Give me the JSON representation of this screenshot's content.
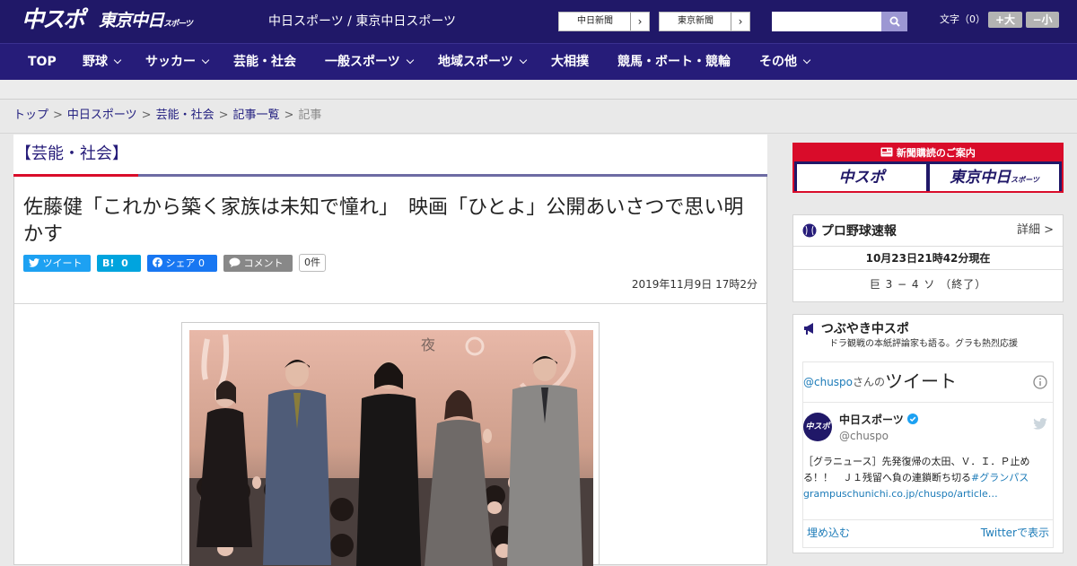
{
  "header": {
    "logo_chuspo": "中スポ",
    "logo_tokyo": "東京中日",
    "logo_tokyo_sub": "スポーツ",
    "site_title": "中日スポーツ / 東京中日スポーツ",
    "ext_links": [
      {
        "label": "中日新聞",
        "arrow": "›"
      },
      {
        "label": "東京新聞",
        "arrow": "›"
      }
    ],
    "search": {
      "placeholder": "",
      "icon": "search-icon"
    },
    "font_size": {
      "label": "文字（0）",
      "larger": "+大",
      "smaller": "−小"
    }
  },
  "nav": [
    {
      "label": "TOP",
      "dropdown": false
    },
    {
      "label": "野球",
      "dropdown": true
    },
    {
      "label": "サッカー",
      "dropdown": true
    },
    {
      "label": "芸能・社会",
      "dropdown": false
    },
    {
      "label": "一般スポーツ",
      "dropdown": true
    },
    {
      "label": "地域スポーツ",
      "dropdown": true
    },
    {
      "label": "大相撲",
      "dropdown": false
    },
    {
      "label": "競馬・ボート・競輪",
      "dropdown": false
    },
    {
      "label": "その他",
      "dropdown": true
    }
  ],
  "breadcrumb": {
    "items": [
      "トップ",
      "中日スポーツ",
      "芸能・社会",
      "記事一覧"
    ],
    "current": "記事",
    "separator": ">"
  },
  "article": {
    "category": "【芸能・社会】",
    "title": "佐藤健「これから築く家族は未知で憧れ」　映画「ひとよ」公開あいさつで思い明かす",
    "share": {
      "tweet": "ツイート",
      "hatena_icon": "B!",
      "hatena_count": "0",
      "facebook": "シェア",
      "facebook_count": "0",
      "comment": "コメント",
      "comment_count": "0件"
    },
    "date": "2019年11月9日 17時2分",
    "photo_overlay_text": "夜"
  },
  "sidebar": {
    "subscribe": {
      "header": "新聞購読のご案内",
      "buttons": [
        "中スポ",
        "東京中日"
      ],
      "tokyo_sub": "スポーツ"
    },
    "baseball": {
      "title": "プロ野球速報",
      "detail": "詳細 >",
      "timestamp": "10月23日21時42分現在",
      "score": "巨 3 − 4 ソ （終了）"
    },
    "tweets": {
      "title": "つぶやき中スポ",
      "subtitle": "ドラ観戦の本紙評論家も語る。グラも熱烈応援",
      "handle_label": "@chuspo",
      "handle_suffix": "さんの",
      "tweet_label": "ツイート",
      "user_name": "中日スポーツ",
      "user_handle": "@chuspo",
      "avatar_text": "中スポ",
      "tweet_text": "［グラニュース］先発復帰の太田、Ｖ．Ｉ．Ｐ止める！！　Ｊ１残留へ負の連鎖断ち切る",
      "tweet_hashtag": "#グランパス",
      "tweet_link": "grampuschunichi.co.jp/chuspo/article…",
      "embed": "埋め込む",
      "view_on_twitter": "Twitterで表示"
    }
  },
  "colors": {
    "header_bg": "#201868",
    "nav_bg": "#261c79",
    "accent_red": "#d90c2a",
    "twitter_blue": "#1da1f2",
    "facebook_blue": "#1877f2",
    "hatena_blue": "#00a4de",
    "comment_gray": "#888888"
  }
}
